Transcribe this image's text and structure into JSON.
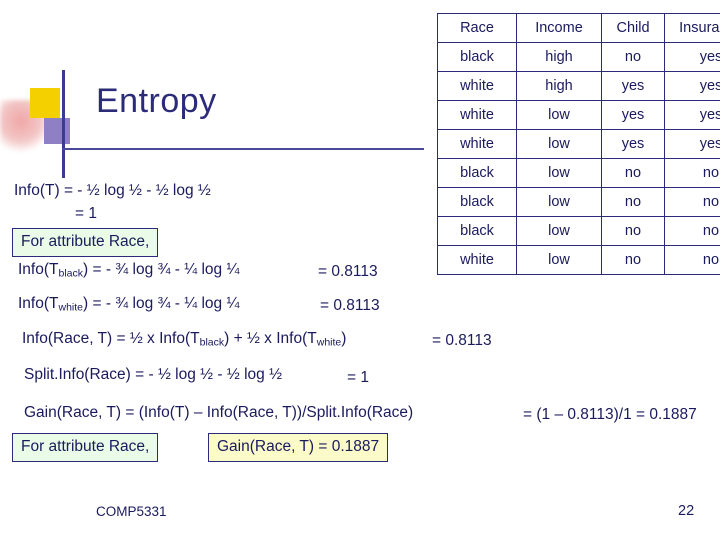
{
  "slide": {
    "title": "Entropy",
    "footer_left": "COMP5331",
    "page_number": "22"
  },
  "table": {
    "headers": [
      "Race",
      "Income",
      "Child",
      "Insurance"
    ],
    "rows": [
      [
        "black",
        "high",
        "no",
        "yes"
      ],
      [
        "white",
        "high",
        "yes",
        "yes"
      ],
      [
        "white",
        "low",
        "yes",
        "yes"
      ],
      [
        "white",
        "low",
        "yes",
        "yes"
      ],
      [
        "black",
        "low",
        "no",
        "no"
      ],
      [
        "black",
        "low",
        "no",
        "no"
      ],
      [
        "black",
        "low",
        "no",
        "no"
      ],
      [
        "white",
        "low",
        "no",
        "no"
      ]
    ]
  },
  "content": {
    "info_t_line1": "Info(T) = - ½ log ½ - ½ log ½",
    "info_t_line2": "= 1",
    "box_attribute_race_1": "For attribute Race,",
    "info_black_expr": "Info(Tblack) = - ¾ log ¾ - ¼ log ¼",
    "info_black_value": "= 0.8113",
    "info_white_expr": "Info(Twhite) = - ¾ log ¾ - ¼ log ¼",
    "info_white_value": "= 0.8113",
    "info_race_expr": "Info(Race, T) = ½ x Info(Tblack) + ½ x Info(Twhite)",
    "info_race_value": "= 0.8113",
    "splitinfo_expr": "Split.Info(Race) = - ½ log ½ - ½ log ½",
    "splitinfo_value": "= 1",
    "gain_expr": "Gain(Race, T) = (Info(T) – Info(Race, T))/Split.Info(Race)",
    "gain_value": "= (1 – 0.8113)/1 = 0.1887",
    "box_attribute_race_2": "For attribute Race,",
    "box_gain_result": "Gain(Race, T) = 0.1887"
  }
}
